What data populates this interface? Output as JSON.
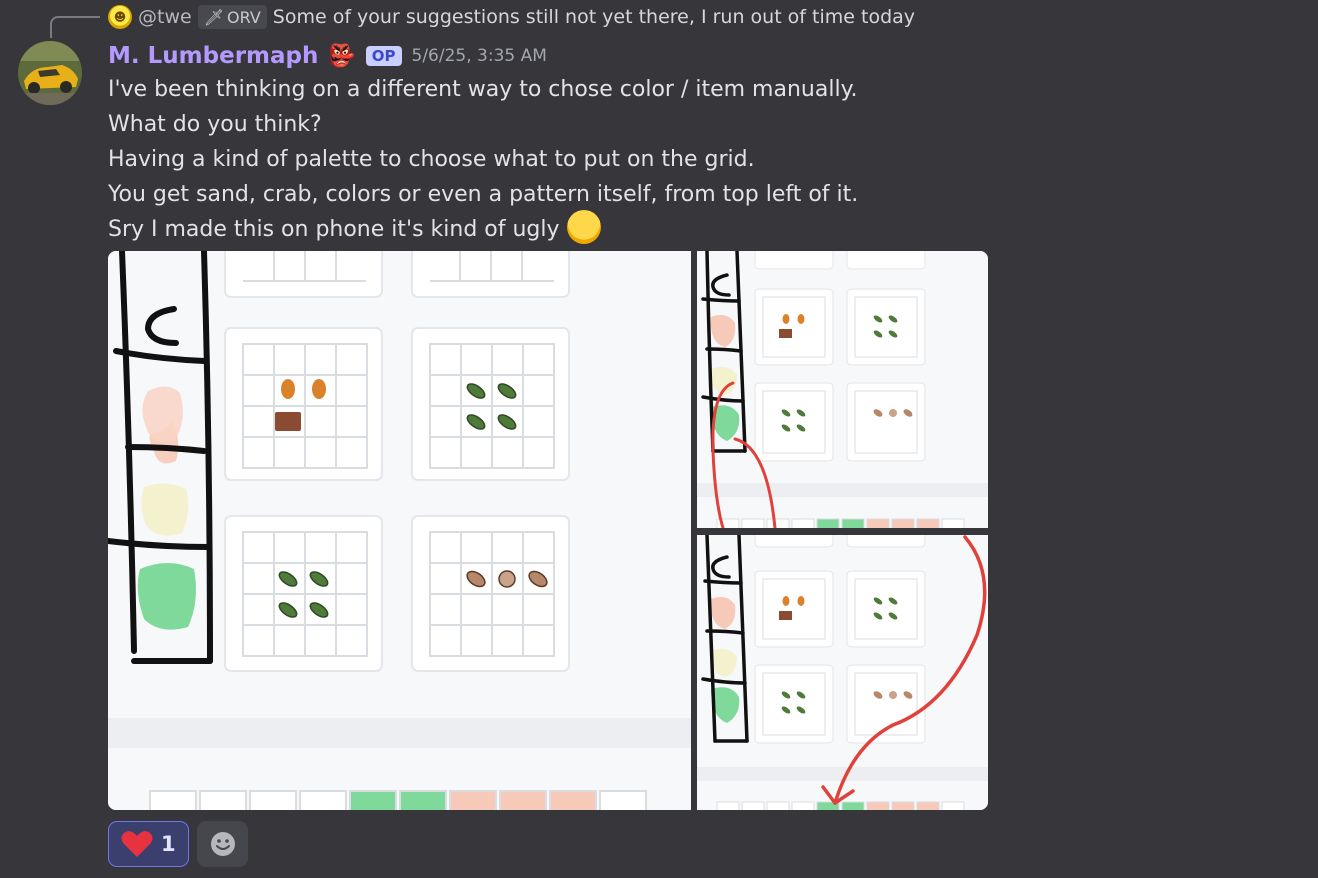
{
  "reply": {
    "username": "@twe",
    "tag": "ORV",
    "text": "Some of your suggestions still not yet there, I run out of time today"
  },
  "message": {
    "author": "M. Lumbermaph",
    "op_badge": "OP",
    "timestamp": "5/6/25, 3:35 AM",
    "lines": [
      "I've been thinking on a different way to chose color / item manually.",
      "What do you think?",
      "Having a kind of palette to choose what to put on the grid.",
      "You get sand, crab, colors or even a pattern itself, from top left of it.",
      "Sry I made this on phone it's kind of ugly"
    ]
  },
  "reactions": [
    {
      "emoji": "heart-icon",
      "count": "1"
    }
  ],
  "colors": {
    "background": "#37363b",
    "username": "#b49aff",
    "mention_accent": "#5865f2",
    "palette_green": "#7fd99a",
    "palette_peach": "#f7c9b8",
    "palette_sand": "#f2f0cc",
    "annotation_red": "#e0413a"
  }
}
